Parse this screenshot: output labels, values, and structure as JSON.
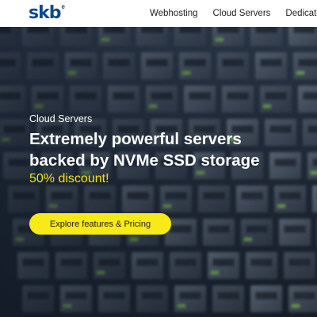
{
  "header": {
    "logo_text": "skb",
    "logo_sup": "e",
    "nav": [
      {
        "label": "Webhosting"
      },
      {
        "label": "Cloud Servers"
      },
      {
        "label": "Dedicated"
      }
    ]
  },
  "hero": {
    "kicker": "Cloud Servers",
    "title_line1": "Extremely powerful servers",
    "title_line2": "backed by NVMe SSD storage",
    "discount": "50% discount!",
    "cta_label": "Explore features & Pricing"
  },
  "colors": {
    "accent": "#f7ea16",
    "brand": "#0e4a86"
  }
}
